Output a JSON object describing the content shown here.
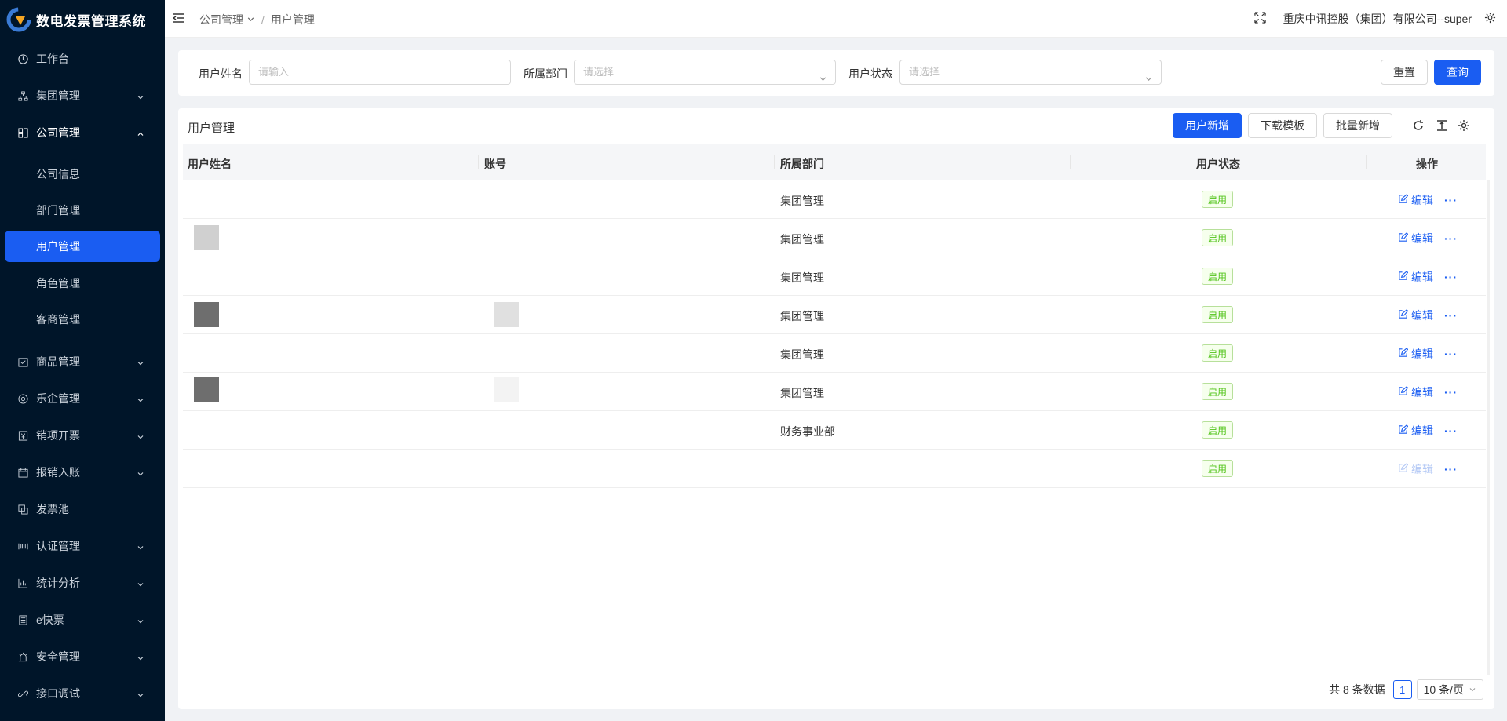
{
  "app": {
    "title": "数电发票管理系统"
  },
  "sidebar": {
    "menu": [
      {
        "label": "工作台",
        "icon": "clock-icon"
      },
      {
        "label": "集团管理",
        "icon": "org-icon"
      },
      {
        "label": "公司管理",
        "icon": "building-icon"
      },
      {
        "label": "商品管理",
        "icon": "checklist-icon"
      },
      {
        "label": "乐企管理",
        "icon": "chrome-icon"
      },
      {
        "label": "销项开票",
        "icon": "invoice-icon"
      },
      {
        "label": "报销入账",
        "icon": "calendar-icon"
      },
      {
        "label": "发票池",
        "icon": "copy-icon"
      },
      {
        "label": "认证管理",
        "icon": "barcode-icon"
      },
      {
        "label": "统计分析",
        "icon": "bar-chart-icon"
      },
      {
        "label": "e快票",
        "icon": "document-icon"
      },
      {
        "label": "安全管理",
        "icon": "alarm-icon"
      },
      {
        "label": "接口调试",
        "icon": "link-icon"
      }
    ],
    "company_sub": [
      "公司信息",
      "部门管理",
      "用户管理",
      "角色管理",
      "客商管理"
    ]
  },
  "header": {
    "breadcrumb": [
      "公司管理",
      "用户管理"
    ],
    "company": "重庆中讯控股（集团）有限公司--super"
  },
  "filter": {
    "name_label": "用户姓名",
    "name_placeholder": "请输入",
    "dept_label": "所属部门",
    "dept_placeholder": "请选择",
    "status_label": "用户状态",
    "status_placeholder": "请选择",
    "reset": "重置",
    "query": "查询"
  },
  "table": {
    "title": "用户管理",
    "btn_add": "用户新增",
    "btn_template": "下载模板",
    "btn_batch": "批量新增",
    "columns": [
      "用户姓名",
      "账号",
      "所属部门",
      "用户状态",
      "操作"
    ],
    "rows": [
      {
        "dept": "集团管理",
        "status": "启用",
        "edit": "编辑"
      },
      {
        "dept": "集团管理",
        "status": "启用",
        "edit": "编辑"
      },
      {
        "dept": "集团管理",
        "status": "启用",
        "edit": "编辑"
      },
      {
        "dept": "集团管理",
        "status": "启用",
        "edit": "编辑"
      },
      {
        "dept": "集团管理",
        "status": "启用",
        "edit": "编辑"
      },
      {
        "dept": "集团管理",
        "status": "启用",
        "edit": "编辑"
      },
      {
        "dept": "财务事业部",
        "status": "启用",
        "edit": "编辑"
      },
      {
        "dept": "",
        "status": "启用",
        "edit": "编辑"
      }
    ],
    "more": "···"
  },
  "pagination": {
    "total": "共 8 条数据",
    "page": "1",
    "size": "10 条/页"
  },
  "colors": {
    "sidebar_bg": "#001529",
    "primary": "#1a5df2",
    "tag_green": "#52c41a"
  }
}
